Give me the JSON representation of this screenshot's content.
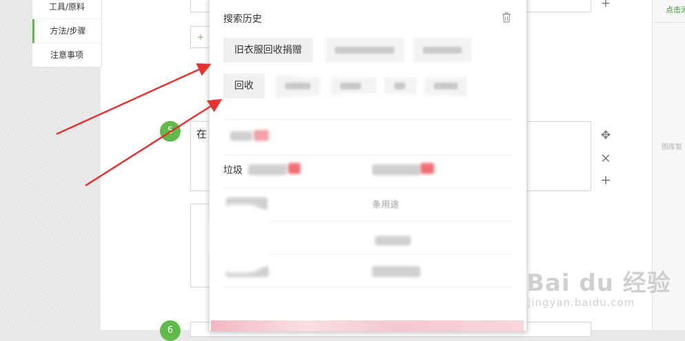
{
  "nav": {
    "items": [
      {
        "label": "工具/原料"
      },
      {
        "label": "方法/步骤"
      },
      {
        "label": "注意事项"
      }
    ]
  },
  "right_panel": {
    "link": "点击添加",
    "note": "图库暂"
  },
  "editor": {
    "add_label": "+",
    "step_text": "在",
    "step_numbers": [
      "5",
      "6"
    ],
    "tools": {
      "move": "✥",
      "close": "×",
      "add": "+"
    },
    "top_plus": "+"
  },
  "search_dropdown": {
    "title": "搜索历史",
    "history": [
      "旧衣服回收捐赠",
      "回收"
    ],
    "blurred_texts": [
      "优酷VIP会员",
      "笔"
    ],
    "suggestions": [
      "垃圾",
      "条用途"
    ]
  },
  "watermark": {
    "brand": "Bai du 经验",
    "url": "jingyan.baidu.com"
  },
  "colors": {
    "accent_green": "#5fba4a",
    "arrow_red": "#e8302e"
  }
}
